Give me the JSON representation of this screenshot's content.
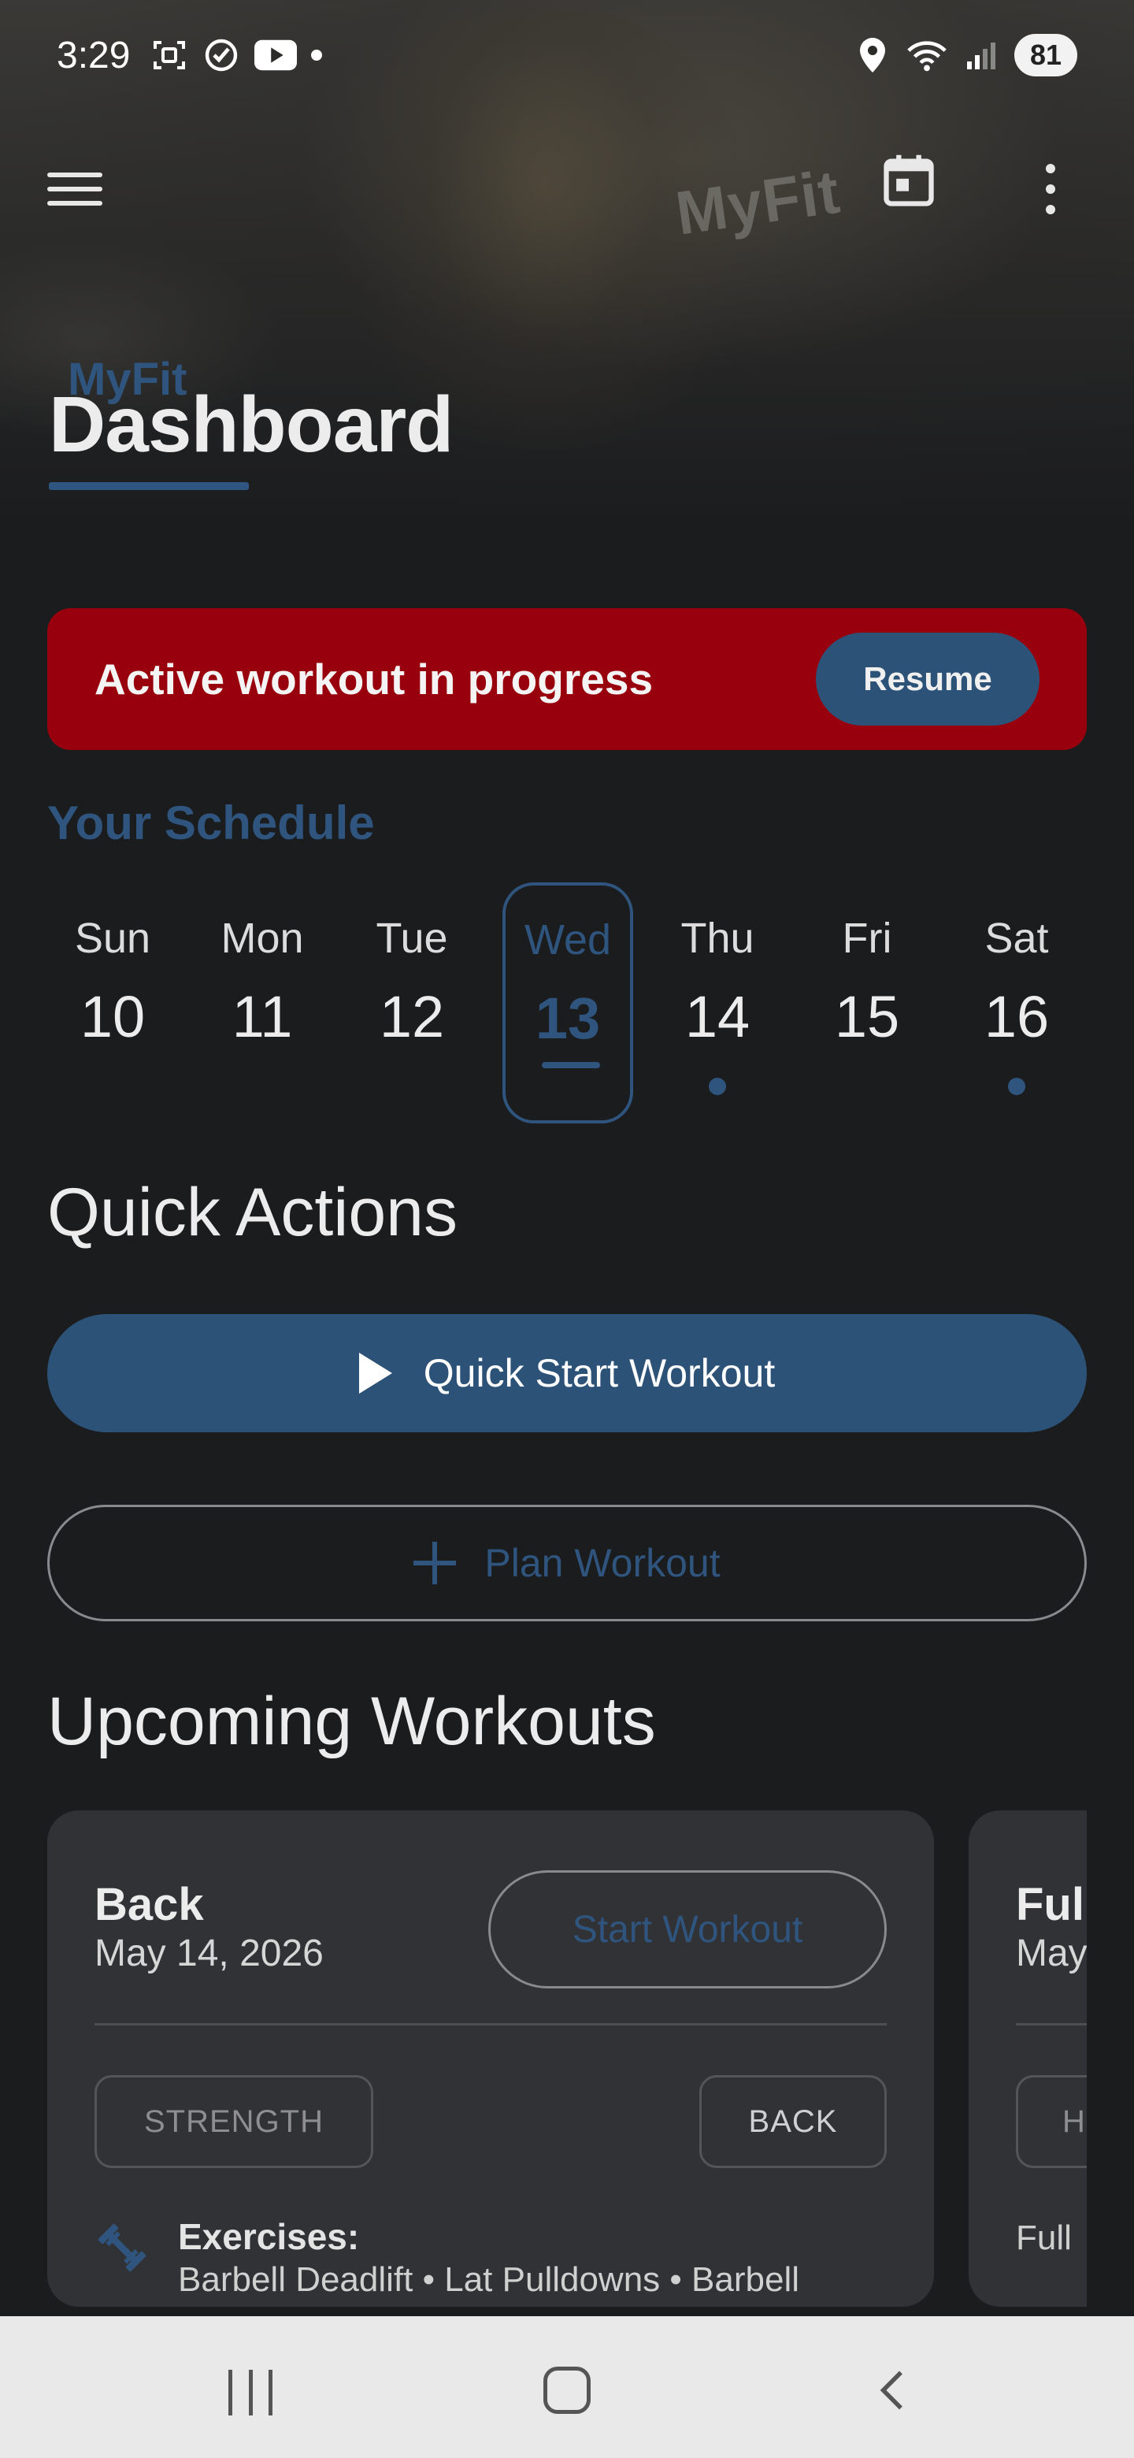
{
  "status_bar": {
    "time": "3:29",
    "battery": "81",
    "icons": [
      "screenshot-icon",
      "check-circle-icon",
      "youtube-icon",
      "location-icon",
      "wifi-icon",
      "signal-icon"
    ]
  },
  "app_bar": {
    "menu_icon": "hamburger-menu-icon",
    "calendar_icon": "calendar-icon",
    "more_icon": "more-vertical-icon"
  },
  "hero": {
    "sign_text": "MyFit"
  },
  "header": {
    "brand": "MyFit",
    "title": "Dashboard"
  },
  "active_workout": {
    "text": "Active workout in progress",
    "resume_label": "Resume"
  },
  "schedule": {
    "label": "Your Schedule",
    "days": [
      {
        "name": "Sun",
        "num": "10",
        "selected": false,
        "has_workout": false
      },
      {
        "name": "Mon",
        "num": "11",
        "selected": false,
        "has_workout": false
      },
      {
        "name": "Tue",
        "num": "12",
        "selected": false,
        "has_workout": false
      },
      {
        "name": "Wed",
        "num": "13",
        "selected": true,
        "has_workout": false
      },
      {
        "name": "Thu",
        "num": "14",
        "selected": false,
        "has_workout": true
      },
      {
        "name": "Fri",
        "num": "15",
        "selected": false,
        "has_workout": false
      },
      {
        "name": "Sat",
        "num": "16",
        "selected": false,
        "has_workout": true
      }
    ]
  },
  "quick_actions": {
    "title": "Quick Actions",
    "quick_start_label": "Quick Start Workout",
    "plan_label": "Plan Workout"
  },
  "upcoming": {
    "title": "Upcoming Workouts",
    "cards": [
      {
        "title": "Back",
        "date": "May 14, 2026",
        "start_label": "Start Workout",
        "tags": [
          "STRENGTH",
          "BACK"
        ],
        "exercises_label": "Exercises:",
        "exercises": "Barbell Deadlift • Lat Pulldowns • Barbell"
      },
      {
        "title": "Full",
        "date": "May",
        "tag": "H",
        "text": "Full"
      }
    ]
  },
  "colors": {
    "accent": "#2d5278",
    "accent_text": "#2f557f",
    "banner_red": "#99000d",
    "background": "#1b1c1e",
    "card": "#313236"
  }
}
